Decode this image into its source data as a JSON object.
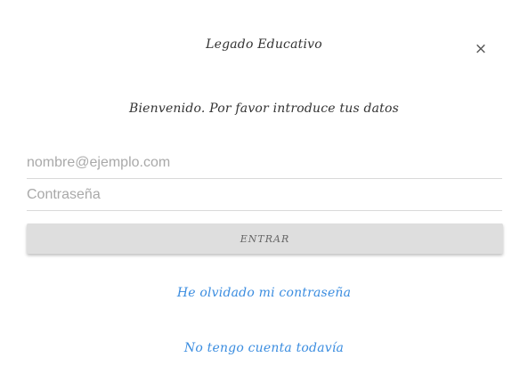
{
  "dialog": {
    "title": "Legado Educativo",
    "close_label": "×",
    "welcome": "Bienvenido. Por favor introduce tus datos"
  },
  "form": {
    "email_placeholder": "nombre@ejemplo.com",
    "email_value": "",
    "password_placeholder": "Contraseña",
    "password_value": "",
    "submit_label": "ENTRAR"
  },
  "links": {
    "forgot_password": "He olvidado mi contraseña",
    "no_account": "No tengo cuenta todavía"
  },
  "colors": {
    "link": "#3b8de0",
    "button_bg": "#dedede",
    "divider": "#d9d9d9"
  },
  "icons": {
    "close": "close-icon"
  }
}
